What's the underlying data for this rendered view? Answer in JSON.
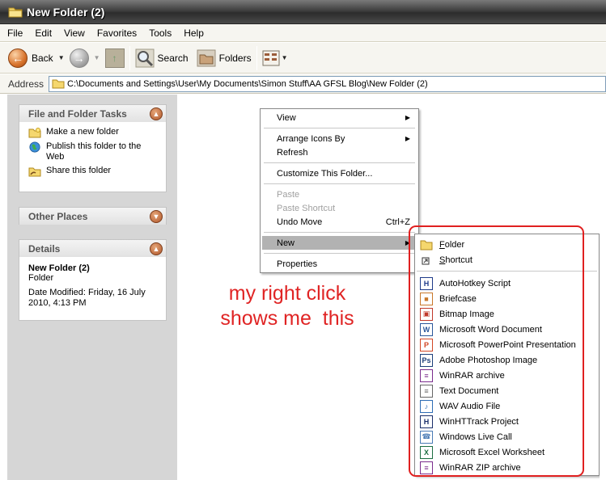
{
  "window": {
    "title": "New Folder (2)"
  },
  "menubar": {
    "items": [
      "File",
      "Edit",
      "View",
      "Favorites",
      "Tools",
      "Help"
    ]
  },
  "toolbar": {
    "back_label": "Back",
    "search_label": "Search",
    "folders_label": "Folders"
  },
  "address": {
    "label": "Address",
    "value": "C:\\Documents and Settings\\User\\My Documents\\Simon Stuff\\AA GFSL Blog\\New Folder (2)"
  },
  "taskpane": {
    "file_tasks": {
      "title": "File and Folder Tasks",
      "items": [
        "Make a new folder",
        "Publish this folder to the Web",
        "Share this folder"
      ]
    },
    "other_places": {
      "title": "Other Places"
    },
    "details": {
      "title": "Details",
      "name": "New Folder (2)",
      "type": "Folder",
      "modified": "Date Modified: Friday, 16 July 2010, 4:13 PM"
    }
  },
  "context_menu": {
    "view": "View",
    "arrange": "Arrange Icons By",
    "refresh": "Refresh",
    "customize": "Customize This Folder...",
    "paste": "Paste",
    "paste_shortcut": "Paste Shortcut",
    "undo_move": "Undo Move",
    "undo_shortcut": "Ctrl+Z",
    "new": "New",
    "properties": "Properties"
  },
  "new_submenu": {
    "folder_first": "F",
    "folder_rest": "older",
    "shortcut_first": "S",
    "shortcut_rest": "hortcut",
    "items": [
      {
        "label": "AutoHotkey Script",
        "icon": "autohotkey-icon",
        "color": "#1f3b8a"
      },
      {
        "label": "Briefcase",
        "icon": "briefcase-icon",
        "color": "#c8782a"
      },
      {
        "label": "Bitmap Image",
        "icon": "bitmap-icon",
        "color": "#c0392b"
      },
      {
        "label": "Microsoft Word Document",
        "icon": "word-doc-icon",
        "color": "#2b579a"
      },
      {
        "label": "Microsoft PowerPoint Presentation",
        "icon": "powerpoint-icon",
        "color": "#d24726"
      },
      {
        "label": "Adobe Photoshop Image",
        "icon": "photoshop-icon",
        "color": "#1c3f7a"
      },
      {
        "label": "WinRAR archive",
        "icon": "winrar-icon",
        "color": "#7b2d8e"
      },
      {
        "label": "Text Document",
        "icon": "text-doc-icon",
        "color": "#666666"
      },
      {
        "label": "WAV Audio File",
        "icon": "wav-audio-icon",
        "color": "#2f6db5"
      },
      {
        "label": "WinHTTrack Project",
        "icon": "httrack-icon",
        "color": "#1b2f6b"
      },
      {
        "label": "Windows Live Call",
        "icon": "live-call-icon",
        "color": "#4a7bb5"
      },
      {
        "label": "Microsoft Excel Worksheet",
        "icon": "excel-icon",
        "color": "#1d6f42"
      },
      {
        "label": "WinRAR ZIP archive",
        "icon": "winrar-zip-icon",
        "color": "#7b2d8e"
      }
    ]
  },
  "annotation": {
    "line1": "my right click",
    "line2": "shows me  this"
  }
}
